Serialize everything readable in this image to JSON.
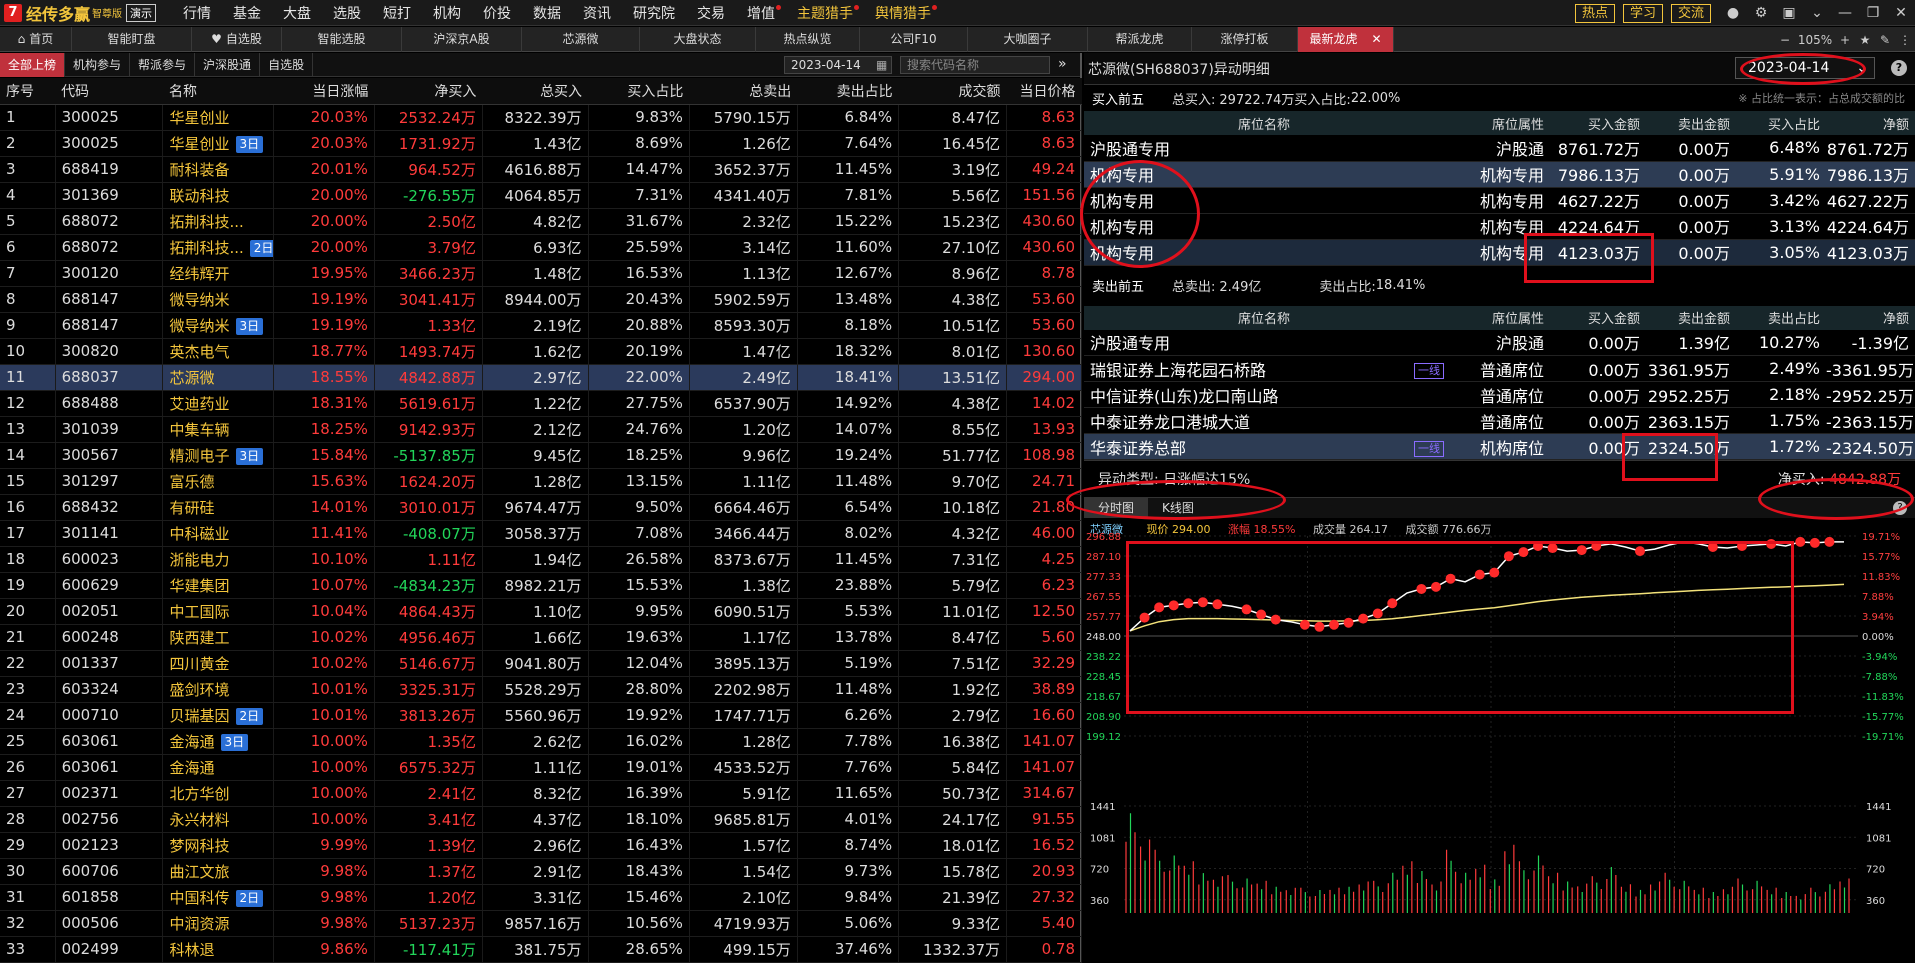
{
  "app": {
    "logo_mark": "7",
    "name": "经传多赢",
    "edition": "智尊版",
    "demo": "演示",
    "menu": [
      "行情",
      "基金",
      "大盘",
      "选股",
      "短打",
      "机构",
      "价投",
      "数据",
      "资讯",
      "研究院",
      "交易",
      "增值",
      "主题猎手",
      "舆情猎手"
    ],
    "right_buttons": [
      "热点",
      "学习",
      "交流"
    ],
    "window_icons": [
      "user-icon",
      "gear-icon",
      "window-icon",
      "chevron-down-icon",
      "minimize-icon",
      "restore-icon",
      "close-icon"
    ]
  },
  "tabs": [
    "首页",
    "智能盯盘",
    "自选股",
    "智能选股",
    "沪深京A股",
    "芯源微",
    "大盘状态",
    "热点纵览",
    "公司F10",
    "大咖圈子",
    "帮派龙虎",
    "涨停打板",
    "最新龙虎"
  ],
  "tab_tools": {
    "minus": "−",
    "zoom": "105%",
    "plus": "+"
  },
  "left_panel": {
    "subtabs": [
      "全部上榜",
      "机构参与",
      "帮派参与",
      "沪深股通",
      "自选股"
    ],
    "date": "2023-04-14",
    "search_placeholder": "搜索代码名称",
    "columns": [
      "序号",
      "代码",
      "名称",
      "当日涨幅",
      "净买入",
      "总买入",
      "买入占比",
      "总卖出",
      "卖出占比",
      "成交额",
      "当日价格"
    ],
    "rows": [
      {
        "no": "1",
        "code": "300025",
        "name": "华星创业",
        "badge": "",
        "pct": "20.03%",
        "net": "2532.24万",
        "buy": "8322.39万",
        "buyr": "9.83%",
        "sell": "5790.15万",
        "sellr": "6.84%",
        "amt": "8.47亿",
        "price": "8.63"
      },
      {
        "no": "2",
        "code": "300025",
        "name": "华星创业",
        "badge": "3日",
        "pct": "20.03%",
        "net": "1731.92万",
        "buy": "1.43亿",
        "buyr": "8.69%",
        "sell": "1.26亿",
        "sellr": "7.64%",
        "amt": "16.45亿",
        "price": "8.63"
      },
      {
        "no": "3",
        "code": "688419",
        "name": "耐科装备",
        "badge": "",
        "pct": "20.01%",
        "net": "964.52万",
        "buy": "4616.88万",
        "buyr": "14.47%",
        "sell": "3652.37万",
        "sellr": "11.45%",
        "amt": "3.19亿",
        "price": "49.24"
      },
      {
        "no": "4",
        "code": "301369",
        "name": "联动科技",
        "badge": "",
        "pct": "20.00%",
        "net": "-276.55万",
        "buy": "4064.85万",
        "buyr": "7.31%",
        "sell": "4341.40万",
        "sellr": "7.81%",
        "amt": "5.56亿",
        "price": "151.56"
      },
      {
        "no": "5",
        "code": "688072",
        "name": "拓荆科技...",
        "badge": "",
        "pct": "20.00%",
        "net": "2.50亿",
        "buy": "4.82亿",
        "buyr": "31.67%",
        "sell": "2.32亿",
        "sellr": "15.22%",
        "amt": "15.23亿",
        "price": "430.60"
      },
      {
        "no": "6",
        "code": "688072",
        "name": "拓荆科技...",
        "badge": "2日",
        "pct": "20.00%",
        "net": "3.79亿",
        "buy": "6.93亿",
        "buyr": "25.59%",
        "sell": "3.14亿",
        "sellr": "11.60%",
        "amt": "27.10亿",
        "price": "430.60"
      },
      {
        "no": "7",
        "code": "300120",
        "name": "经纬辉开",
        "badge": "",
        "pct": "19.95%",
        "net": "3466.23万",
        "buy": "1.48亿",
        "buyr": "16.53%",
        "sell": "1.13亿",
        "sellr": "12.67%",
        "amt": "8.96亿",
        "price": "8.78"
      },
      {
        "no": "8",
        "code": "688147",
        "name": "微导纳米",
        "badge": "",
        "pct": "19.19%",
        "net": "3041.41万",
        "buy": "8944.00万",
        "buyr": "20.43%",
        "sell": "5902.59万",
        "sellr": "13.48%",
        "amt": "4.38亿",
        "price": "53.60"
      },
      {
        "no": "9",
        "code": "688147",
        "name": "微导纳米",
        "badge": "3日",
        "pct": "19.19%",
        "net": "1.33亿",
        "buy": "2.19亿",
        "buyr": "20.88%",
        "sell": "8593.30万",
        "sellr": "8.18%",
        "amt": "10.51亿",
        "price": "53.60"
      },
      {
        "no": "10",
        "code": "300820",
        "name": "英杰电气",
        "badge": "",
        "pct": "18.77%",
        "net": "1493.74万",
        "buy": "1.62亿",
        "buyr": "20.19%",
        "sell": "1.47亿",
        "sellr": "18.32%",
        "amt": "8.01亿",
        "price": "130.60"
      },
      {
        "no": "11",
        "code": "688037",
        "name": "芯源微",
        "badge": "",
        "pct": "18.55%",
        "net": "4842.88万",
        "buy": "2.97亿",
        "buyr": "22.00%",
        "sell": "2.49亿",
        "sellr": "18.41%",
        "amt": "13.51亿",
        "price": "294.00"
      },
      {
        "no": "12",
        "code": "688488",
        "name": "艾迪药业",
        "badge": "",
        "pct": "18.31%",
        "net": "5619.61万",
        "buy": "1.22亿",
        "buyr": "27.75%",
        "sell": "6537.90万",
        "sellr": "14.92%",
        "amt": "4.38亿",
        "price": "14.02"
      },
      {
        "no": "13",
        "code": "301039",
        "name": "中集车辆",
        "badge": "",
        "pct": "18.25%",
        "net": "9142.93万",
        "buy": "2.12亿",
        "buyr": "24.76%",
        "sell": "1.20亿",
        "sellr": "14.07%",
        "amt": "8.55亿",
        "price": "13.93"
      },
      {
        "no": "14",
        "code": "300567",
        "name": "精测电子",
        "badge": "3日",
        "pct": "15.84%",
        "net": "-5137.85万",
        "buy": "9.45亿",
        "buyr": "18.25%",
        "sell": "9.96亿",
        "sellr": "19.24%",
        "amt": "51.77亿",
        "price": "108.98"
      },
      {
        "no": "15",
        "code": "301297",
        "name": "富乐德",
        "badge": "",
        "pct": "15.63%",
        "net": "1624.20万",
        "buy": "1.28亿",
        "buyr": "13.15%",
        "sell": "1.11亿",
        "sellr": "11.48%",
        "amt": "9.70亿",
        "price": "24.71"
      },
      {
        "no": "16",
        "code": "688432",
        "name": "有研硅",
        "badge": "",
        "pct": "14.01%",
        "net": "3010.01万",
        "buy": "9674.47万",
        "buyr": "9.50%",
        "sell": "6664.46万",
        "sellr": "6.54%",
        "amt": "10.18亿",
        "price": "21.80"
      },
      {
        "no": "17",
        "code": "301141",
        "name": "中科磁业",
        "badge": "",
        "pct": "11.41%",
        "net": "-408.07万",
        "buy": "3058.37万",
        "buyr": "7.08%",
        "sell": "3466.44万",
        "sellr": "8.02%",
        "amt": "4.32亿",
        "price": "46.00"
      },
      {
        "no": "18",
        "code": "600023",
        "name": "浙能电力",
        "badge": "",
        "pct": "10.10%",
        "net": "1.11亿",
        "buy": "1.94亿",
        "buyr": "26.58%",
        "sell": "8373.67万",
        "sellr": "11.45%",
        "amt": "7.31亿",
        "price": "4.25"
      },
      {
        "no": "19",
        "code": "600629",
        "name": "华建集团",
        "badge": "",
        "pct": "10.07%",
        "net": "-4834.23万",
        "buy": "8982.21万",
        "buyr": "15.53%",
        "sell": "1.38亿",
        "sellr": "23.88%",
        "amt": "5.79亿",
        "price": "6.23"
      },
      {
        "no": "20",
        "code": "002051",
        "name": "中工国际",
        "badge": "",
        "pct": "10.04%",
        "net": "4864.43万",
        "buy": "1.10亿",
        "buyr": "9.95%",
        "sell": "6090.51万",
        "sellr": "5.53%",
        "amt": "11.01亿",
        "price": "12.50"
      },
      {
        "no": "21",
        "code": "600248",
        "name": "陕西建工",
        "badge": "",
        "pct": "10.02%",
        "net": "4956.46万",
        "buy": "1.66亿",
        "buyr": "19.63%",
        "sell": "1.17亿",
        "sellr": "13.78%",
        "amt": "8.47亿",
        "price": "5.60"
      },
      {
        "no": "22",
        "code": "001337",
        "name": "四川黄金",
        "badge": "",
        "pct": "10.02%",
        "net": "5146.67万",
        "buy": "9041.80万",
        "buyr": "12.04%",
        "sell": "3895.13万",
        "sellr": "5.19%",
        "amt": "7.51亿",
        "price": "32.29"
      },
      {
        "no": "23",
        "code": "603324",
        "name": "盛剑环境",
        "badge": "",
        "pct": "10.01%",
        "net": "3325.31万",
        "buy": "5528.29万",
        "buyr": "28.80%",
        "sell": "2202.98万",
        "sellr": "11.48%",
        "amt": "1.92亿",
        "price": "38.89"
      },
      {
        "no": "24",
        "code": "000710",
        "name": "贝瑞基因",
        "badge": "2日",
        "pct": "10.01%",
        "net": "3813.26万",
        "buy": "5560.96万",
        "buyr": "19.92%",
        "sell": "1747.71万",
        "sellr": "6.26%",
        "amt": "2.79亿",
        "price": "16.60"
      },
      {
        "no": "25",
        "code": "603061",
        "name": "金海通",
        "badge": "3日",
        "pct": "10.00%",
        "net": "1.35亿",
        "buy": "2.62亿",
        "buyr": "16.02%",
        "sell": "1.28亿",
        "sellr": "7.78%",
        "amt": "16.38亿",
        "price": "141.07"
      },
      {
        "no": "26",
        "code": "603061",
        "name": "金海通",
        "badge": "",
        "pct": "10.00%",
        "net": "6575.32万",
        "buy": "1.11亿",
        "buyr": "19.01%",
        "sell": "4533.52万",
        "sellr": "7.76%",
        "amt": "5.84亿",
        "price": "141.07"
      },
      {
        "no": "27",
        "code": "002371",
        "name": "北方华创",
        "badge": "",
        "pct": "10.00%",
        "net": "2.41亿",
        "buy": "8.32亿",
        "buyr": "16.39%",
        "sell": "5.91亿",
        "sellr": "11.65%",
        "amt": "50.73亿",
        "price": "314.67"
      },
      {
        "no": "28",
        "code": "002756",
        "name": "永兴材料",
        "badge": "",
        "pct": "10.00%",
        "net": "3.41亿",
        "buy": "4.37亿",
        "buyr": "18.10%",
        "sell": "9685.81万",
        "sellr": "4.01%",
        "amt": "24.17亿",
        "price": "91.55"
      },
      {
        "no": "29",
        "code": "002123",
        "name": "梦网科技",
        "badge": "",
        "pct": "9.99%",
        "net": "1.39亿",
        "buy": "2.96亿",
        "buyr": "16.43%",
        "sell": "1.57亿",
        "sellr": "8.74%",
        "amt": "18.01亿",
        "price": "16.52"
      },
      {
        "no": "30",
        "code": "600706",
        "name": "曲江文旅",
        "badge": "",
        "pct": "9.98%",
        "net": "1.37亿",
        "buy": "2.91亿",
        "buyr": "18.43%",
        "sell": "1.54亿",
        "sellr": "9.73%",
        "amt": "15.78亿",
        "price": "20.93"
      },
      {
        "no": "31",
        "code": "601858",
        "name": "中国科传",
        "badge": "2日",
        "pct": "9.98%",
        "net": "1.20亿",
        "buy": "3.31亿",
        "buyr": "15.46%",
        "sell": "2.10亿",
        "sellr": "9.84%",
        "amt": "21.39亿",
        "price": "27.32"
      },
      {
        "no": "32",
        "code": "000506",
        "name": "中润资源",
        "badge": "",
        "pct": "9.98%",
        "net": "5137.23万",
        "buy": "9857.16万",
        "buyr": "10.56%",
        "sell": "4719.93万",
        "sellr": "5.06%",
        "amt": "9.33亿",
        "price": "5.40"
      },
      {
        "no": "33",
        "code": "002499",
        "name": "科林退",
        "badge": "",
        "pct": "9.86%",
        "net": "-117.41万",
        "buy": "381.75万",
        "buyr": "28.65%",
        "sell": "499.15万",
        "sellr": "37.46%",
        "amt": "1332.37万",
        "price": "0.78"
      }
    ]
  },
  "right_panel": {
    "title": "芯源微(SH688037)异动明细",
    "date": "2023-04-14",
    "help": "?",
    "buy_head": {
      "label": "买入前五",
      "total_label": "总买入:",
      "total": "29722.74万",
      "ratio_label": "买入占比:",
      "ratio": "22.00%",
      "note": "※ 占比统一表示：占总成交额的比"
    },
    "columns": [
      "席位名称",
      "席位属性",
      "买入金额",
      "卖出金额",
      "买入占比",
      "净额"
    ],
    "buy_rows": [
      {
        "name": "沪股通专用",
        "tag": "",
        "attr": "沪股通",
        "buy": "8761.72万",
        "sell": "0.00万",
        "ratio": "6.48%",
        "net": "8761.72万"
      },
      {
        "name": "机构专用",
        "tag": "",
        "attr": "机构专用",
        "buy": "7986.13万",
        "sell": "0.00万",
        "ratio": "5.91%",
        "net": "7986.13万"
      },
      {
        "name": "机构专用",
        "tag": "",
        "attr": "机构专用",
        "buy": "4627.22万",
        "sell": "0.00万",
        "ratio": "3.42%",
        "net": "4627.22万"
      },
      {
        "name": "机构专用",
        "tag": "",
        "attr": "机构专用",
        "buy": "4224.64万",
        "sell": "0.00万",
        "ratio": "3.13%",
        "net": "4224.64万"
      },
      {
        "name": "机构专用",
        "tag": "",
        "attr": "机构专用",
        "buy": "4123.03万",
        "sell": "0.00万",
        "ratio": "3.05%",
        "net": "4123.03万"
      }
    ],
    "sell_head": {
      "label": "卖出前五",
      "total_label": "总卖出:",
      "total": "2.49亿",
      "ratio_label": "卖出占比:",
      "ratio": "18.41%"
    },
    "sell_columns": [
      "席位名称",
      "席位属性",
      "买入金额",
      "卖出金额",
      "卖出占比",
      "净额"
    ],
    "sell_rows": [
      {
        "name": "沪股通专用",
        "tag": "",
        "attr": "沪股通",
        "buy": "0.00万",
        "sell": "1.39亿",
        "ratio": "10.27%",
        "net": "-1.39亿"
      },
      {
        "name": "瑞银证券上海花园石桥路",
        "tag": "一线",
        "attr": "普通席位",
        "buy": "0.00万",
        "sell": "3361.95万",
        "ratio": "2.49%",
        "net": "-3361.95万"
      },
      {
        "name": "中信证券(山东)龙口南山路",
        "tag": "",
        "attr": "普通席位",
        "buy": "0.00万",
        "sell": "2952.25万",
        "ratio": "2.18%",
        "net": "-2952.25万"
      },
      {
        "name": "中泰证券龙口港城大道",
        "tag": "",
        "attr": "普通席位",
        "buy": "0.00万",
        "sell": "2363.15万",
        "ratio": "1.75%",
        "net": "-2363.15万"
      },
      {
        "name": "华泰证券总部",
        "tag": "一线",
        "attr": "机构席位",
        "buy": "0.00万",
        "sell": "2324.50万",
        "ratio": "1.72%",
        "net": "-2324.50万"
      }
    ],
    "summary": {
      "type_label": "异动类型:",
      "type": "日涨幅达15%",
      "net_label": "净买入:",
      "net": "4842.88万"
    },
    "chart_tabs": [
      "分时图",
      "K线图"
    ],
    "chart_info": {
      "name": "芯源微",
      "price_label": "现价",
      "price": "294.00",
      "pct_label": "涨幅",
      "pct": "18.55%",
      "vol_label": "成交量",
      "vol": "264.17",
      "amt_label": "成交额",
      "amt": "776.66万"
    }
  },
  "chart_data": {
    "type": "line",
    "title": "",
    "price_ticks": [
      "296.88",
      "287.10",
      "277.33",
      "267.55",
      "257.77",
      "248.00",
      "238.22",
      "228.45",
      "218.67",
      "208.90",
      "199.12"
    ],
    "pct_ticks": [
      "19.71%",
      "15.77%",
      "11.83%",
      "7.88%",
      "3.94%",
      "0.00%",
      "-3.94%",
      "-7.88%",
      "-11.83%",
      "-15.77%",
      "-19.71%"
    ],
    "volume_ticks": [
      "1441",
      "1081",
      "720",
      "360"
    ],
    "ylim": [
      199.12,
      296.88
    ],
    "prev_close": 248.0,
    "series": [
      {
        "values": [
          250.5,
          257,
          262,
          263,
          264,
          264.5,
          263.5,
          262.5,
          261,
          258.5,
          256,
          255,
          253.5,
          252.5,
          253.5,
          254.5,
          256.5,
          259,
          264,
          269,
          271,
          272,
          276,
          274.5,
          278,
          279,
          287,
          289,
          292,
          291,
          289.5,
          290,
          292,
          293,
          291.5,
          289.5,
          290.5,
          292.5,
          294,
          293,
          291.5,
          291,
          292,
          292.5,
          293,
          292,
          294,
          293.5,
          294,
          294
        ]
      },
      {
        "values": [
          250.5,
          253,
          255,
          256,
          256.5,
          256.5,
          256.5,
          256.3,
          256.2,
          256,
          255.8,
          255.6,
          255.5,
          255.3,
          255.3,
          255.4,
          255.6,
          255.9,
          256.4,
          257.2,
          258,
          258.8,
          259.7,
          260.5,
          261.2,
          261.8,
          262.8,
          263.8,
          264.8,
          265.6,
          266.3,
          266.9,
          267.4,
          267.9,
          268.3,
          268.7,
          269.1,
          269.5,
          269.9,
          270.3,
          270.6,
          270.9,
          271.2,
          271.5,
          271.8,
          272,
          272.3,
          272.6,
          272.9,
          273.2
        ]
      }
    ],
    "marker_points": [
      1,
      2,
      3,
      4,
      5,
      6,
      8,
      9,
      10,
      12,
      13,
      14,
      15,
      16,
      17,
      18,
      20,
      21,
      22,
      24,
      25,
      26,
      27,
      28,
      29,
      31,
      32,
      35,
      40,
      42,
      44,
      46,
      47,
      48
    ],
    "volume": [
      0.95,
      0.7,
      0.55,
      0.5,
      0.45,
      0.38,
      0.35,
      0.33,
      0.3,
      0.28,
      0.25,
      0.24,
      0.22,
      0.2,
      0.22,
      0.25,
      0.3,
      0.28,
      0.35,
      0.45,
      0.4,
      0.3,
      0.55,
      0.35,
      0.42,
      0.32,
      0.65,
      0.45,
      0.5,
      0.35,
      0.3,
      0.28,
      0.32,
      0.4,
      0.25,
      0.22,
      0.3,
      0.35,
      0.28,
      0.22,
      0.2,
      0.25,
      0.3,
      0.28,
      0.22,
      0.2,
      0.18,
      0.22,
      0.25,
      0.3
    ]
  }
}
